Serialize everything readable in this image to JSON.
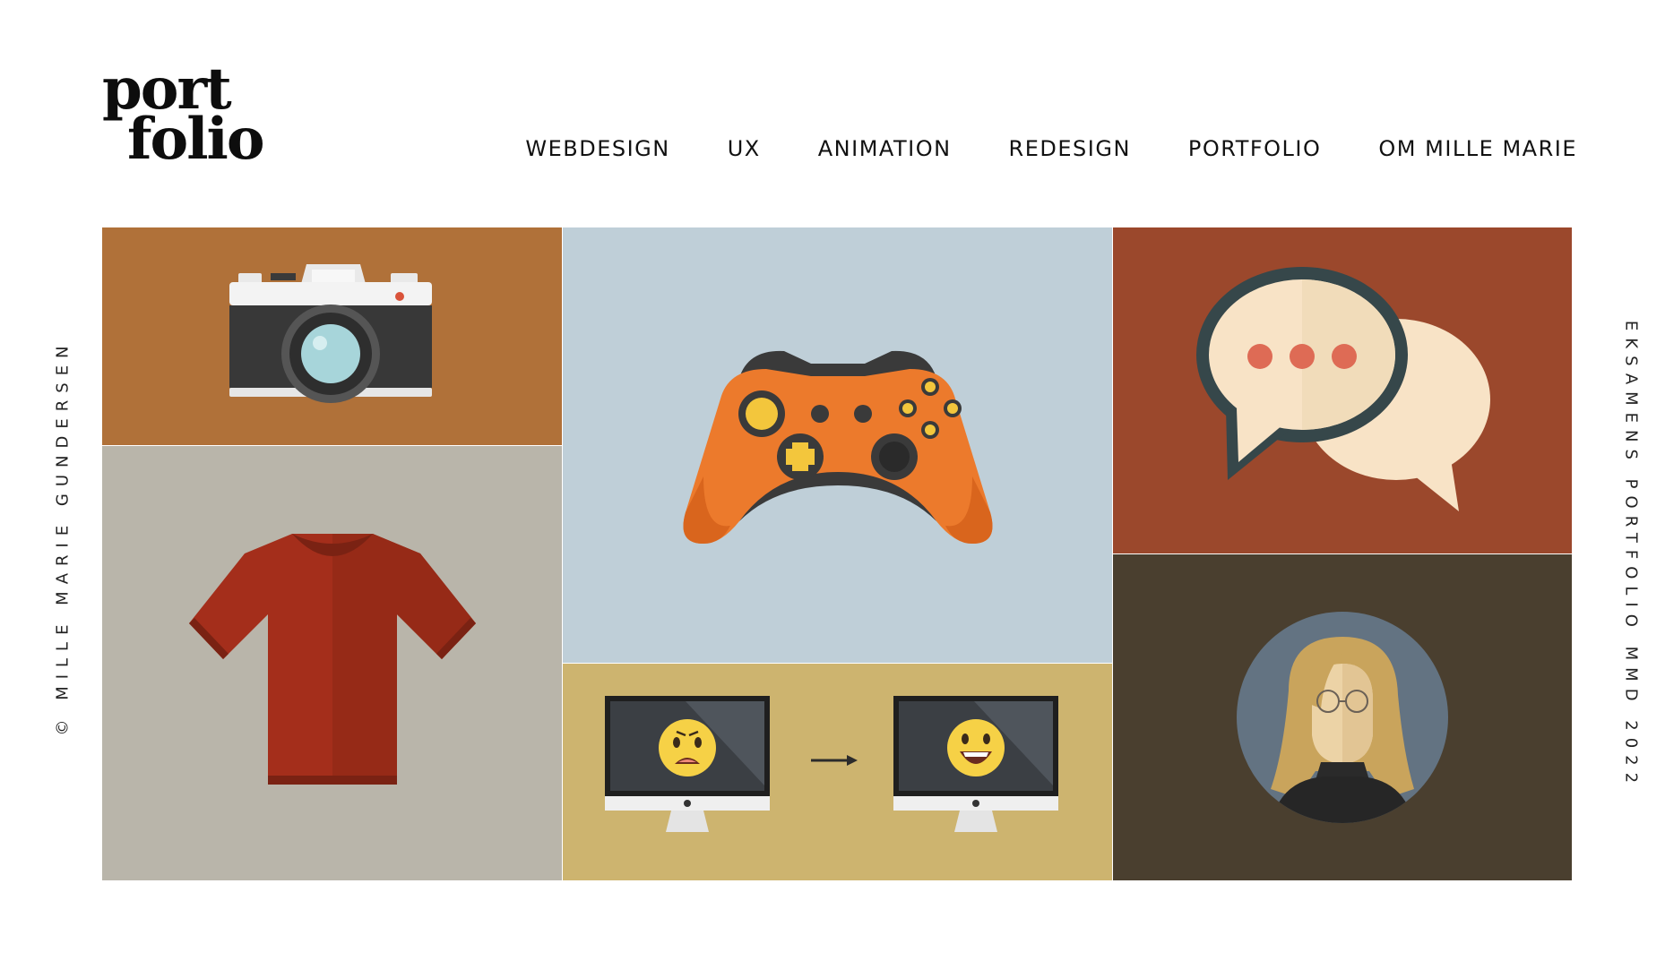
{
  "logo": {
    "line1": "port",
    "line2": "folio"
  },
  "nav": {
    "items": [
      {
        "label": "WEBDESIGN"
      },
      {
        "label": "UX"
      },
      {
        "label": "ANIMATION"
      },
      {
        "label": "REDESIGN"
      },
      {
        "label": "PORTFOLIO"
      },
      {
        "label": "OM MILLE MARIE"
      }
    ]
  },
  "side": {
    "left": "© MILLE MARIE GUNDERSEN",
    "right": "EKSAMENS PORTFOLIO MMD 2022"
  },
  "tiles": [
    {
      "icon": "camera-icon",
      "color": "#b07139"
    },
    {
      "icon": "tshirt-icon",
      "color": "#b9b5aa"
    },
    {
      "icon": "game-controller-icon",
      "color": "#bfcfd8"
    },
    {
      "icon": "monitor-emoji-icon",
      "color": "#cdb46f"
    },
    {
      "icon": "chat-bubbles-icon",
      "color": "#9b482c"
    },
    {
      "icon": "avatar-portrait-icon",
      "color": "#4a3f2f"
    }
  ]
}
